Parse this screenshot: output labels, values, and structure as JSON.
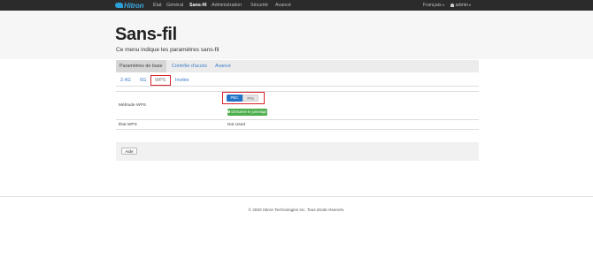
{
  "navbar": {
    "logo_text": "Hitron",
    "items": [
      "État",
      "Général",
      "Sans-fil",
      "Administration",
      "Sécurité",
      "Avancé"
    ],
    "active_item": "Sans-fil",
    "language": "Français",
    "user": "admin"
  },
  "header": {
    "title": "Sans-fil",
    "subtitle": "Ce menu indique les paramètres sans-fil"
  },
  "top_tabs": [
    "Paramètres de base",
    "Contrôle d'accès",
    "Avancé"
  ],
  "sub_tabs": [
    "2.4G",
    "5G",
    "WPS",
    "Invités"
  ],
  "wps": {
    "method_label": "Méthode WPS",
    "method_options": [
      "PBC",
      "PIN"
    ],
    "selected_method": "PBC",
    "start_button": "Démarrer le jumelage",
    "state_label": "État WPS",
    "state_value": "Not Used"
  },
  "help_button": "Aide",
  "footer": "© 2020 Hitron Technologies Inc.  Tous droits réservés.",
  "colors": {
    "navbar_bg": "#2b2b2b",
    "link": "#3a7bc8",
    "selected_toggle": "#2273c6",
    "start_button": "#4cae4c",
    "highlight_box": "#d8232a"
  }
}
